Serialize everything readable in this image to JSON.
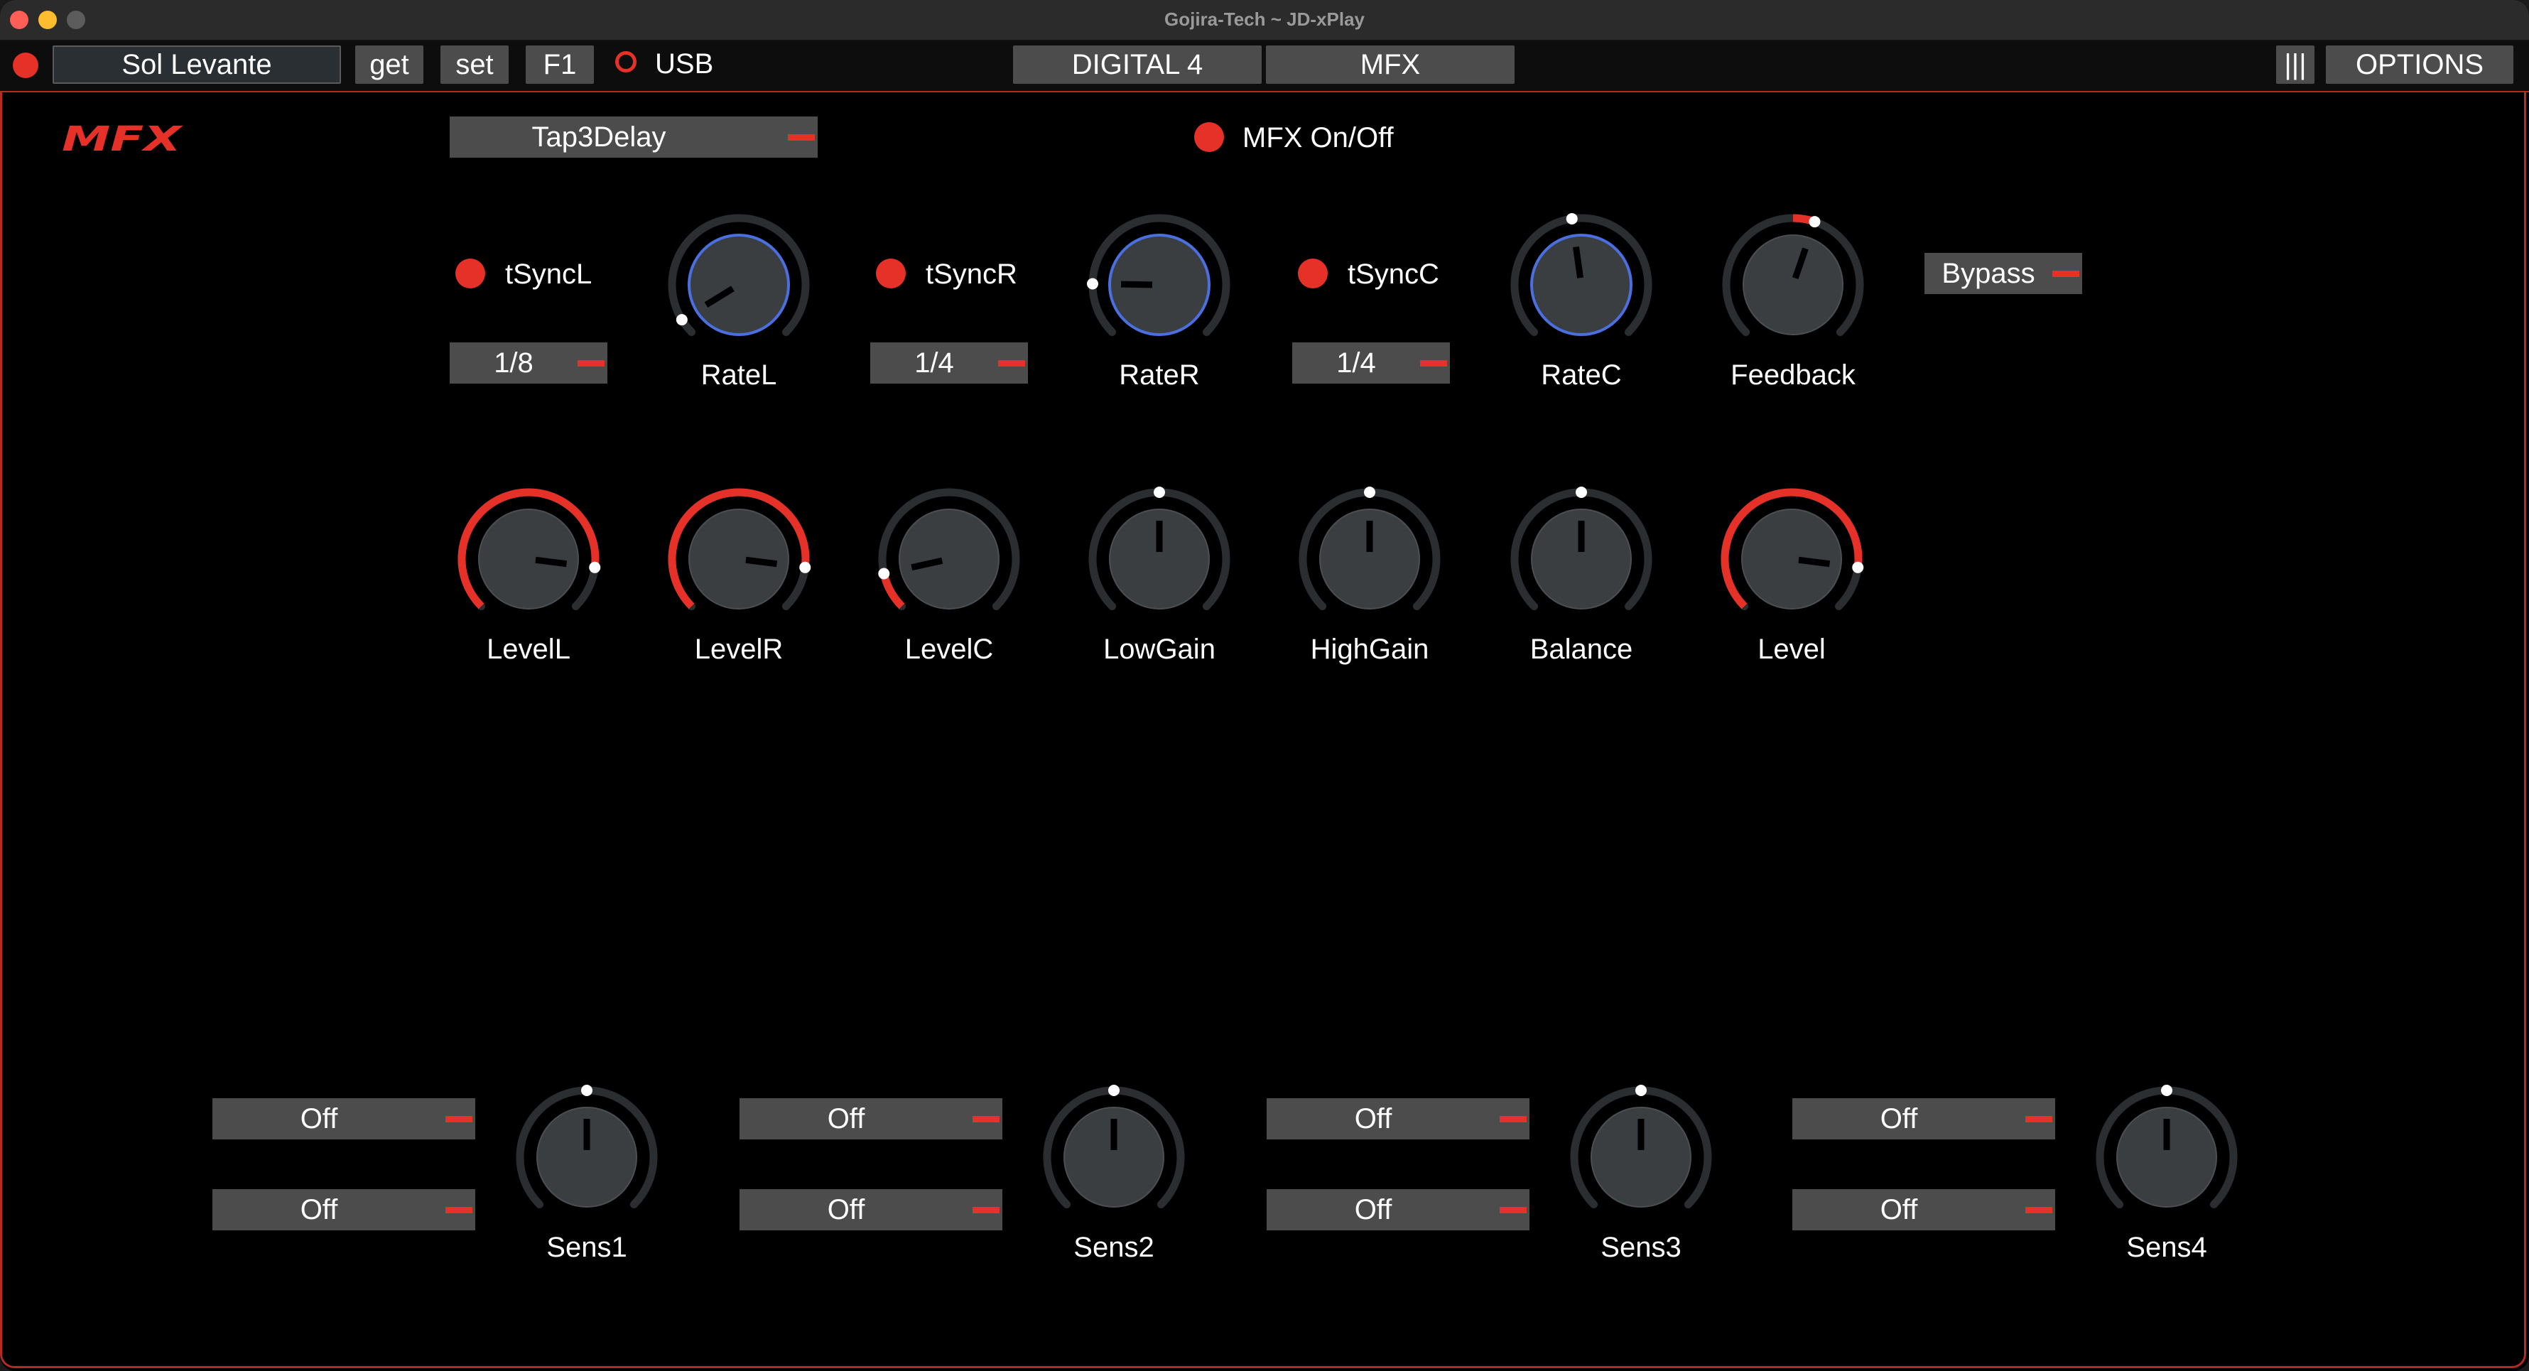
{
  "window": {
    "title": "Gojira-Tech ~ JD-xPlay"
  },
  "toolbar": {
    "patch_name": "Sol Levante",
    "get_label": "get",
    "set_label": "set",
    "f1_label": "F1",
    "usb_label": "USB",
    "tab_digital": "DIGITAL 4",
    "tab_mfx": "MFX",
    "menu_label": "|||",
    "options_label": "OPTIONS"
  },
  "mfx": {
    "section_title": "MFX",
    "type_value": "Tap3Delay",
    "onoff_label": "MFX On/Off",
    "bypass_label": "Bypass",
    "sync": [
      {
        "label": "tSyncL",
        "value": "1/8"
      },
      {
        "label": "tSyncR",
        "value": "1/4"
      },
      {
        "label": "tSyncC",
        "value": "1/4"
      }
    ],
    "rate_knobs": [
      {
        "label": "RateL",
        "value": 0.05
      },
      {
        "label": "RateR",
        "value": 0.17
      },
      {
        "label": "RateC",
        "value": 0.47
      }
    ],
    "feedback_knob": {
      "label": "Feedback",
      "value": 0.57
    },
    "level_knobs": [
      {
        "label": "LevelL",
        "value": 0.86
      },
      {
        "label": "LevelR",
        "value": 0.86
      },
      {
        "label": "LevelC",
        "value": 0.12
      },
      {
        "label": "LowGain",
        "value": 0.5
      },
      {
        "label": "HighGain",
        "value": 0.5
      },
      {
        "label": "Balance",
        "value": 0.5
      },
      {
        "label": "Level",
        "value": 0.86
      }
    ],
    "sens": [
      {
        "label": "Sens1",
        "value": 0.5,
        "opt1": "Off",
        "opt2": "Off"
      },
      {
        "label": "Sens2",
        "value": 0.5,
        "opt1": "Off",
        "opt2": "Off"
      },
      {
        "label": "Sens3",
        "value": 0.5,
        "opt1": "Off",
        "opt2": "Off"
      },
      {
        "label": "Sens4",
        "value": 0.5,
        "opt1": "Off",
        "opt2": "Off"
      }
    ]
  },
  "colors": {
    "accent_red": "#e53128",
    "rate_ring_blue": "#4a6fe0",
    "control_gray": "#4c4c4c",
    "knob_body": "#3a3e41",
    "knob_track": "#2a2e31"
  }
}
